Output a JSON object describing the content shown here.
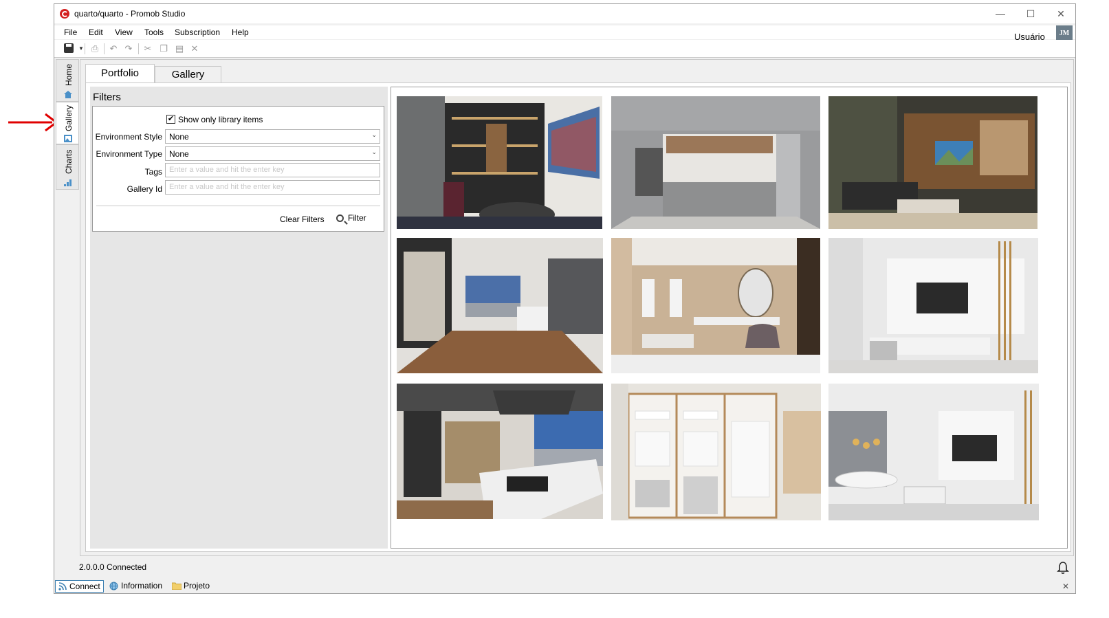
{
  "window": {
    "title": "quarto/quarto - Promob Studio",
    "controls": {
      "minimize": "—",
      "maximize": "☐",
      "close": "✕"
    }
  },
  "menu": {
    "items": [
      "File",
      "Edit",
      "View",
      "Tools",
      "Subscription",
      "Help"
    ],
    "user": "Usuário",
    "avatar_initials": "JM"
  },
  "sidebar": {
    "tabs": [
      {
        "label": "Home",
        "icon": "home-icon"
      },
      {
        "label": "Gallery",
        "icon": "gallery-icon",
        "active": true
      },
      {
        "label": "Charts",
        "icon": "charts-icon"
      }
    ]
  },
  "tabs": {
    "portfolio": "Portfolio",
    "gallery": "Gallery",
    "active": "Portfolio"
  },
  "filters": {
    "title": "Filters",
    "show_only_library": {
      "label": "Show only library items",
      "checked": true
    },
    "environment_style": {
      "label": "Environment Style",
      "value": "None"
    },
    "environment_type": {
      "label": "Environment Type",
      "value": "None"
    },
    "tags": {
      "label": "Tags",
      "placeholder": "Enter a value and hit the enter key"
    },
    "gallery_id": {
      "label": "Gallery Id",
      "placeholder": "Enter a value and hit the enter key"
    },
    "clear_label": "Clear Filters",
    "filter_label": "Filter"
  },
  "gallery": {
    "thumbnails": [
      {
        "name": "thumbnail-shelves-dining"
      },
      {
        "name": "thumbnail-grey-kitchen"
      },
      {
        "name": "thumbnail-living-room-tv"
      },
      {
        "name": "thumbnail-open-kitchen-window"
      },
      {
        "name": "thumbnail-dressing-mirror"
      },
      {
        "name": "thumbnail-white-tv-wall"
      },
      {
        "name": "thumbnail-kitchen-island"
      },
      {
        "name": "thumbnail-white-closet"
      },
      {
        "name": "thumbnail-dining-living"
      }
    ]
  },
  "status": {
    "version": "2.0.0.0",
    "connection": "Connected"
  },
  "bottombar": {
    "connect": "Connect",
    "information": "Information",
    "project": "Projeto",
    "close": "✕"
  },
  "colors": {
    "accent": "#3c7fb1",
    "brand": "#d42020",
    "annotation_arrow": "#e00000"
  }
}
